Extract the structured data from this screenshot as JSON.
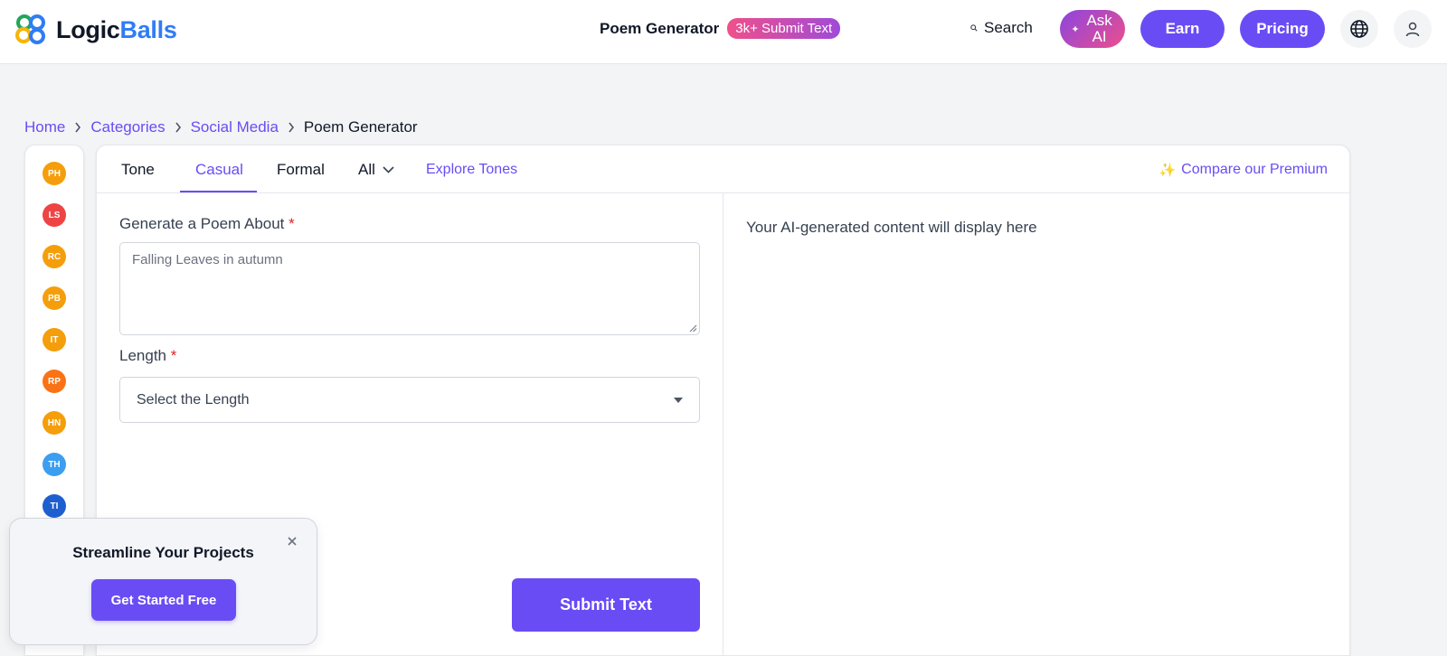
{
  "header": {
    "logo_part1": "Logic",
    "logo_part2": "Balls",
    "title": "Poem Generator",
    "badge": "3k+ Submit Text",
    "search_label": "Search",
    "ask_ai_label": "Ask AI",
    "earn_label": "Earn",
    "pricing_label": "Pricing"
  },
  "breadcrumb": {
    "home": "Home",
    "categories": "Categories",
    "social_media": "Social Media",
    "current": "Poem Generator"
  },
  "sidebar": {
    "items": [
      {
        "initials": "PH",
        "color": "#f59e0b"
      },
      {
        "initials": "LS",
        "color": "#ef4444"
      },
      {
        "initials": "RC",
        "color": "#f59e0b"
      },
      {
        "initials": "PB",
        "color": "#f59e0b"
      },
      {
        "initials": "IT",
        "color": "#f59e0b"
      },
      {
        "initials": "RP",
        "color": "#f97316"
      },
      {
        "initials": "HN",
        "color": "#f59e0b"
      },
      {
        "initials": "TH",
        "color": "#3b9ef0"
      },
      {
        "initials": "TI",
        "color": "#1e5fd0"
      }
    ]
  },
  "tabs": {
    "tone": "Tone",
    "casual": "Casual",
    "formal": "Formal",
    "all": "All",
    "explore": "Explore Tones",
    "premium": "Compare our Premium"
  },
  "form": {
    "topic_label": "Generate a Poem About",
    "required_mark": "*",
    "topic_placeholder": "Falling Leaves in autumn",
    "length_label": "Length",
    "length_selected": "Select the Length",
    "submit_label": "Submit Text"
  },
  "output": {
    "placeholder": "Your AI-generated content will display here"
  },
  "popup": {
    "title": "Streamline Your Projects",
    "button_label": "Get Started Free"
  },
  "colors": {
    "accent": "#6a4cf5",
    "logo_blue": "#2f7cf6"
  }
}
